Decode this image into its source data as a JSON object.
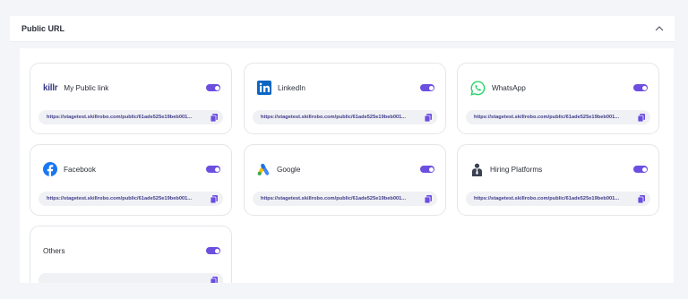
{
  "section": {
    "title": "Public URL",
    "collapse_icon": "chevron-up-icon"
  },
  "accent_color": "#6c4ee0",
  "cards": [
    {
      "label": "My Public link",
      "logo": "killr-logo",
      "url": "https://stagetest.skillrobo.com/public/61ade525e19beb001...",
      "enabled": true
    },
    {
      "label": "LinkedIn",
      "logo": "linkedin-icon",
      "url": "https://stagetest.skillrobo.com/public/61ade525e19beb001...",
      "enabled": true
    },
    {
      "label": "WhatsApp",
      "logo": "whatsapp-icon",
      "url": "https://stagetest.skillrobo.com/public/61ade525e19beb001...",
      "enabled": true
    },
    {
      "label": "Facebook",
      "logo": "facebook-icon",
      "url": "https://stagetest.skillrobo.com/public/61ade525e19beb001...",
      "enabled": true
    },
    {
      "label": "Google",
      "logo": "google-ads-icon",
      "url": "https://stagetest.skillrobo.com/public/61ade525e19beb001...",
      "enabled": true
    },
    {
      "label": "Hiring Platforms",
      "logo": "hiring-platforms-icon",
      "url": "https://stagetest.skillrobo.com/public/61ade525e19beb001...",
      "enabled": true
    },
    {
      "label": "Others",
      "logo": "",
      "url": "",
      "enabled": true
    }
  ],
  "logo_text": {
    "killr": "killr"
  }
}
